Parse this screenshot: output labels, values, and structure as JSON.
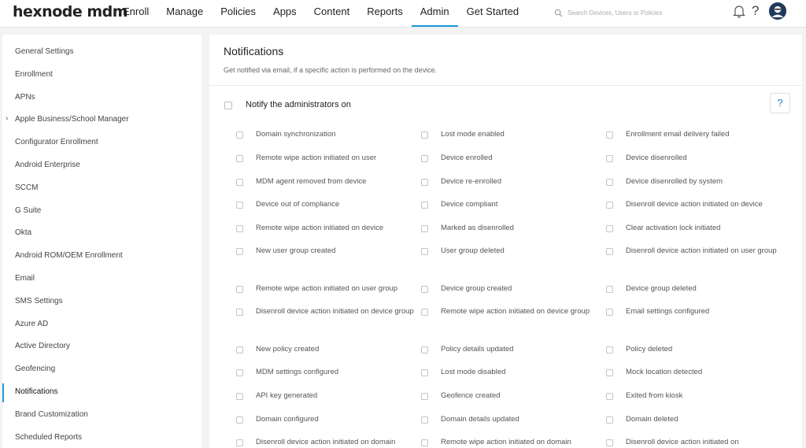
{
  "brand": "hexnode mdm",
  "nav": [
    "Enroll",
    "Manage",
    "Policies",
    "Apps",
    "Content",
    "Reports",
    "Admin",
    "Get Started"
  ],
  "nav_active": "Admin",
  "search": {
    "placeholder": "Search Devices, Users or Policies"
  },
  "topbar_icons": {
    "bell": "bell-icon",
    "help": "?",
    "avatar": "avatar-icon"
  },
  "accent_color": "#1a9bd7",
  "sidebar": {
    "items": [
      "General Settings",
      "Enrollment",
      "APNs",
      "Apple Business/School Manager",
      "Configurator Enrollment",
      "Android Enterprise",
      "SCCM",
      "G Suite",
      "Okta",
      "Android ROM/OEM Enrollment",
      "Email",
      "SMS Settings",
      "Azure AD",
      "Active Directory",
      "Geofencing",
      "Notifications",
      "Brand Customization",
      "Scheduled Reports"
    ],
    "active": "Notifications",
    "expandable": "Apple Business/School Manager"
  },
  "main": {
    "title": "Notifications",
    "subtitle": "Get notified via email, if a specific action is performed on the device.",
    "notify_label": "Notify the administrators on",
    "help_label": "?",
    "options": [
      [
        "Domain synchronization",
        "Lost mode enabled",
        "Enrollment email delivery failed"
      ],
      [
        "Remote wipe action initiated on user",
        "Device enrolled",
        "Device disenrolled"
      ],
      [
        "MDM agent removed from device",
        "Device re-enrolled",
        "Device disenrolled by system"
      ],
      [
        "Device out of compliance",
        "Device compliant",
        "Disenroll device action initiated on device"
      ],
      [
        "Remote wipe action initiated on device",
        "Marked as disenrolled",
        "Clear activation lock initiated"
      ],
      [
        "New user group created",
        "User group deleted",
        "Disenroll device action initiated on user group"
      ],
      [
        "Remote wipe action initiated on user group",
        "Device group created",
        "Device group deleted"
      ],
      [
        "Disenroll device action initiated on device group",
        "Remote wipe action initiated on device group",
        "Email settings configured"
      ],
      [
        "New policy created",
        "Policy details updated",
        "Policy deleted"
      ],
      [
        "MDM settings configured",
        "Lost mode disabled",
        "Mock location detected"
      ],
      [
        "API key generated",
        "Geofence created",
        "Exited from kiosk"
      ],
      [
        "Domain configured",
        "Domain details updated",
        "Domain deleted"
      ],
      [
        "Disenroll device action initiated on domain",
        "Remote wipe action initiated on domain",
        "Disenroll device action initiated on"
      ]
    ]
  }
}
